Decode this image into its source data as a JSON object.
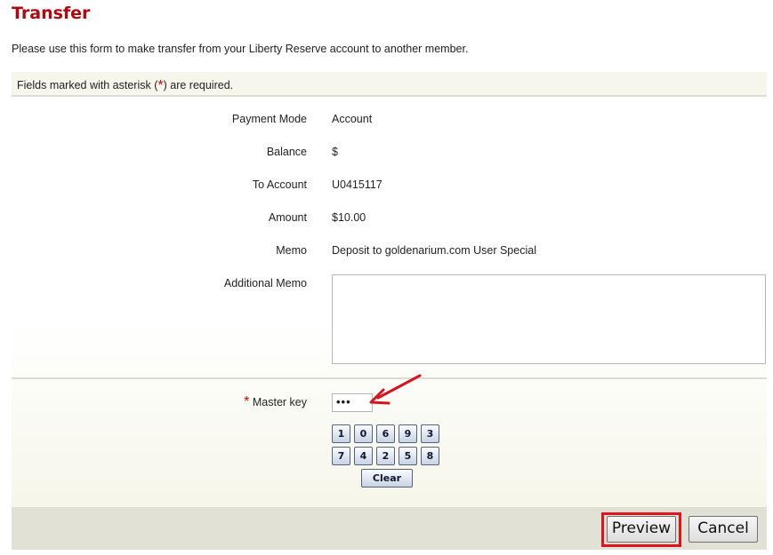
{
  "page": {
    "title": "Transfer",
    "intro": "Please use this form to make transfer from your Liberty Reserve account to another member.",
    "required_note_prefix": "Fields marked with asterisk (",
    "required_star": "*",
    "required_note_suffix": ") are required."
  },
  "fields": {
    "payment_mode": {
      "label": "Payment Mode",
      "value": "Account"
    },
    "balance": {
      "label": "Balance",
      "value": "$"
    },
    "to_account": {
      "label": "To Account",
      "value": "U0415117"
    },
    "amount": {
      "label": "Amount",
      "value": "$10.00"
    },
    "memo": {
      "label": "Memo",
      "value": "Deposit to goldenarium.com User Special"
    },
    "additional_memo": {
      "label": "Additional Memo",
      "value": ""
    },
    "master_key": {
      "label": "Master key",
      "required_star": "*",
      "value": "•••"
    }
  },
  "keypad": {
    "row1": [
      "1",
      "0",
      "6",
      "9",
      "3"
    ],
    "row2": [
      "7",
      "4",
      "2",
      "5",
      "8"
    ],
    "clear_label": "Clear"
  },
  "buttons": {
    "preview": "Preview",
    "cancel": "Cancel"
  },
  "colors": {
    "title": "#b2070e",
    "highlight": "#e0141e",
    "arrow": "#d4141e"
  }
}
